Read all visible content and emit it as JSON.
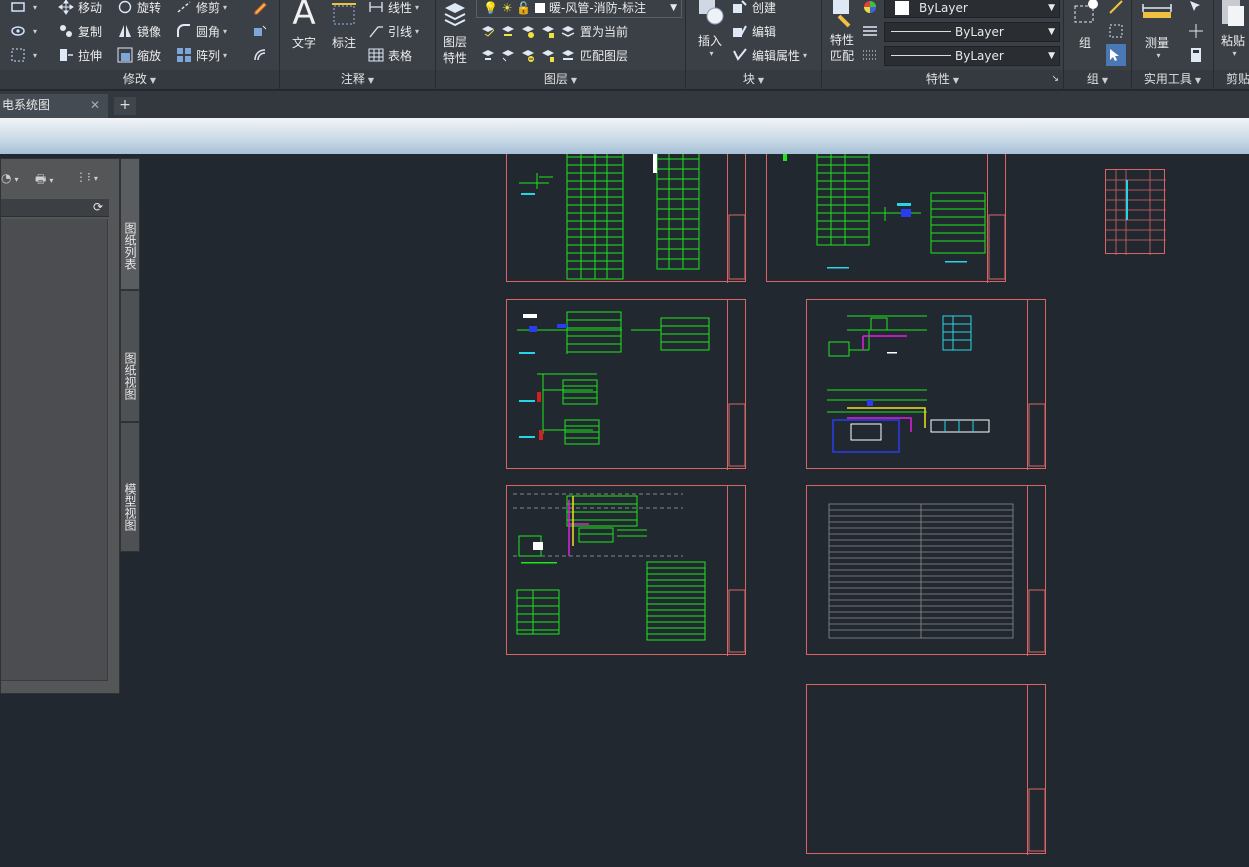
{
  "ribbon": {
    "modify": {
      "title": "修改",
      "tools": {
        "move": "移动",
        "rotate": "旋转",
        "trim": "修剪",
        "copy": "复制",
        "mirror": "镜像",
        "fillet": "圆角",
        "stretch": "拉伸",
        "scale": "缩放",
        "array": "阵列"
      }
    },
    "annotation": {
      "title": "注释",
      "text": "文字",
      "dimension": "标注",
      "linetype": "线性",
      "leader": "引线",
      "table": "表格"
    },
    "layers": {
      "title": "图层",
      "layer_properties": "图层\n特性",
      "current_layer": "暖-风管-消防-标注",
      "set_current": "置为当前",
      "match_layer": "匹配图层"
    },
    "block": {
      "title": "块",
      "insert": "插入",
      "create": "创建",
      "edit": "编辑",
      "edit_attributes": "编辑属性"
    },
    "properties": {
      "title": "特性",
      "match": "特性\n匹配",
      "color": "ByLayer",
      "linetype": "ByLayer",
      "lineweight": "ByLayer"
    },
    "groups": {
      "title": "组",
      "group": "组"
    },
    "utilities": {
      "title": "实用工具",
      "measure": "测量"
    },
    "clipboard": {
      "title": "剪贴",
      "paste": "粘贴"
    }
  },
  "tabs": {
    "doc_tab": "电系统图",
    "new_tab": "+"
  },
  "palette": {
    "side_tabs": [
      "图纸列表",
      "图纸视图",
      "模型视图"
    ]
  },
  "colors": {
    "frame": "#d96464",
    "green": "#1ee61e",
    "cyan": "#27d6e6",
    "magenta": "#e020e0",
    "blue": "#2a3cf0",
    "yellow": "#f0e020",
    "canvas": "#212830"
  }
}
